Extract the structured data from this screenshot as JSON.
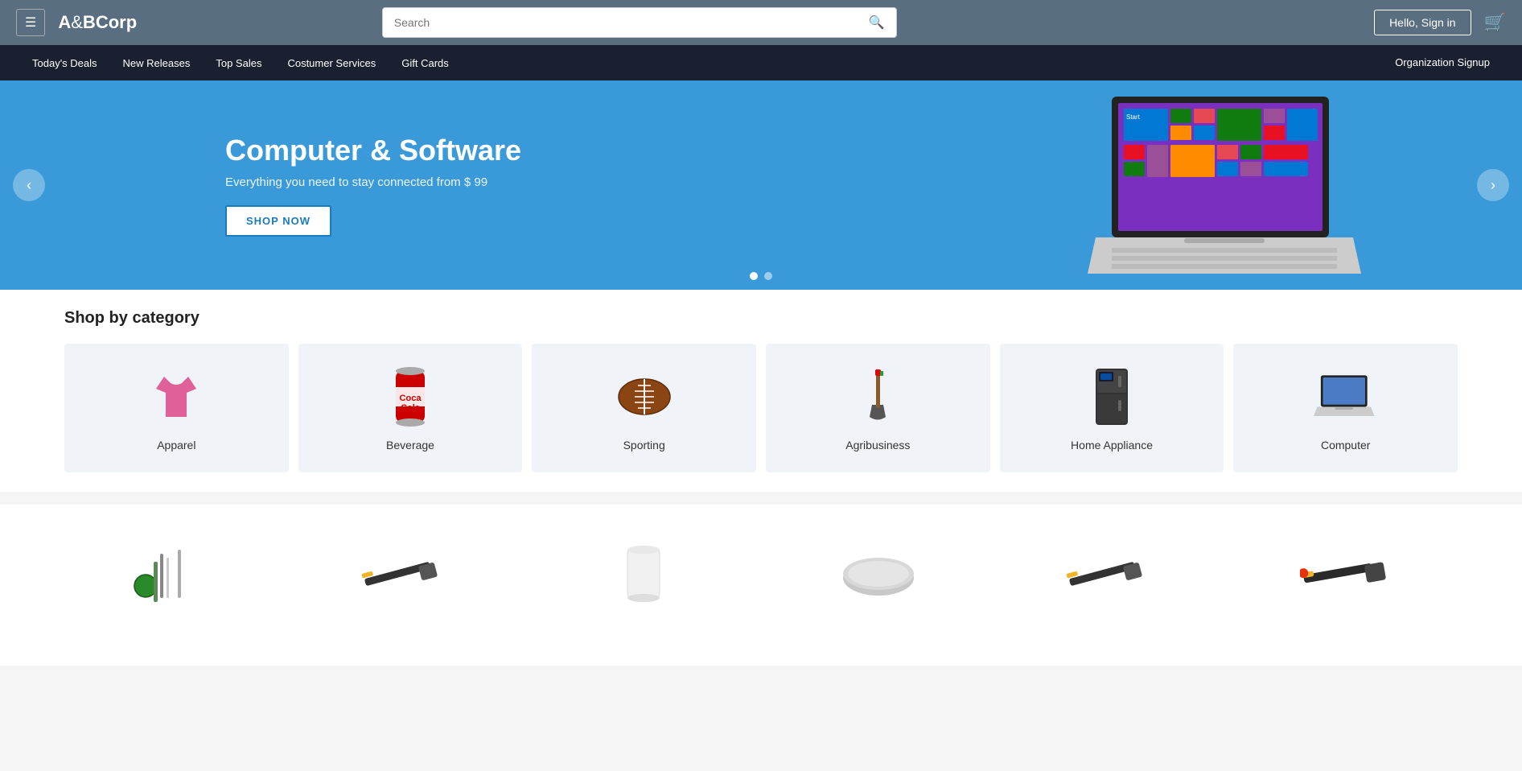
{
  "header": {
    "logo": "A&BCorp",
    "logo_a": "A",
    "logo_amp": "&",
    "logo_b": "B",
    "logo_corp": "Corp",
    "search_placeholder": "Search",
    "signin_label": "Hello, Sign in",
    "cart_label": "Cart"
  },
  "navbar": {
    "items": [
      {
        "id": "todays-deals",
        "label": "Today's Deals"
      },
      {
        "id": "new-releases",
        "label": "New Releases"
      },
      {
        "id": "top-sales",
        "label": "Top Sales"
      },
      {
        "id": "customer-services",
        "label": "Costumer Services"
      },
      {
        "id": "gift-cards",
        "label": "Gift Cards"
      }
    ],
    "right_item": {
      "id": "org-signup",
      "label": "Organization Signup"
    }
  },
  "hero": {
    "title": "Computer & Software",
    "subtitle": "Everything you need to stay connected from $ 99",
    "cta_label": "SHOP NOW",
    "prev_label": "‹",
    "next_label": "›",
    "dots": [
      {
        "active": true
      },
      {
        "active": false
      }
    ]
  },
  "categories_section": {
    "title": "Shop by category",
    "items": [
      {
        "id": "apparel",
        "label": "Apparel",
        "icon": "👕"
      },
      {
        "id": "beverage",
        "label": "Beverage",
        "icon": "🥤"
      },
      {
        "id": "sporting",
        "label": "Sporting",
        "icon": "🏈"
      },
      {
        "id": "agribusiness",
        "label": "Agribusiness",
        "icon": "🪛"
      },
      {
        "id": "home-appliance",
        "label": "Home Appliance",
        "icon": "🖥"
      },
      {
        "id": "computer",
        "label": "Computer",
        "icon": "💻"
      }
    ]
  },
  "products_section": {
    "items": [
      {
        "id": "product-1",
        "icon": "🔧"
      },
      {
        "id": "product-2",
        "icon": "🔨"
      },
      {
        "id": "product-3",
        "icon": "🫙"
      },
      {
        "id": "product-4",
        "icon": "🪣"
      },
      {
        "id": "product-5",
        "icon": "🔨"
      },
      {
        "id": "product-6",
        "icon": "🪓"
      }
    ]
  },
  "colors": {
    "header_bg": "#5a6e82",
    "navbar_bg": "#1a2030",
    "hero_bg": "#3a9ad9",
    "category_bg": "#f0f4f8"
  }
}
